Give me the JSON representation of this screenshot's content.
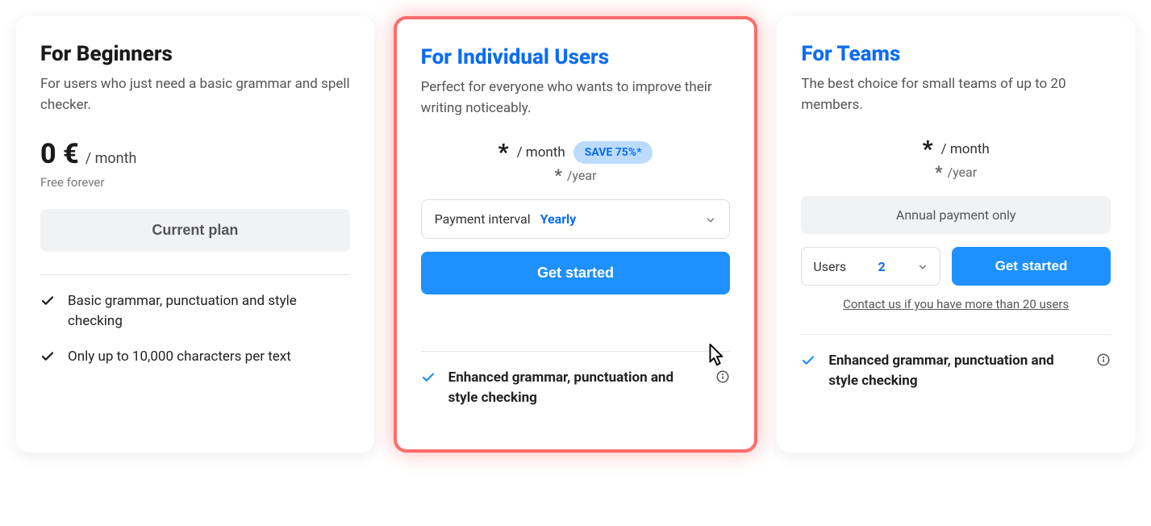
{
  "plans": {
    "beginner": {
      "title": "For Beginners",
      "subtitle": "For users who just need a basic grammar and spell checker.",
      "price_main": "0 €",
      "price_period": "/ month",
      "free_note": "Free forever",
      "cta": "Current plan",
      "features": [
        "Basic grammar, punctuation and style checking",
        "Only up to 10,000 characters per text"
      ]
    },
    "individual": {
      "title": "For Individual Users",
      "subtitle": "Perfect for everyone who wants to improve their writing noticeably.",
      "price_star": "*",
      "price_period": "/ month",
      "save_badge": "SAVE 75%*",
      "price_year_star": "*",
      "price_year_period": "/year",
      "interval_label": "Payment interval",
      "interval_value": "Yearly",
      "cta": "Get started",
      "feature_bold": "Enhanced grammar, punctuation and style checking"
    },
    "team": {
      "title": "For Teams",
      "subtitle": "The best choice for small teams of up to 20 members.",
      "price_star": "*",
      "price_period": "/ month",
      "price_year_star": "*",
      "price_year_period": "/year",
      "annual_note": "Annual payment only",
      "users_label": "Users",
      "users_value": "2",
      "cta": "Get started",
      "contact_link": "Contact us if you have more than 20 users",
      "feature_bold": "Enhanced grammar, punctuation and style checking"
    }
  }
}
